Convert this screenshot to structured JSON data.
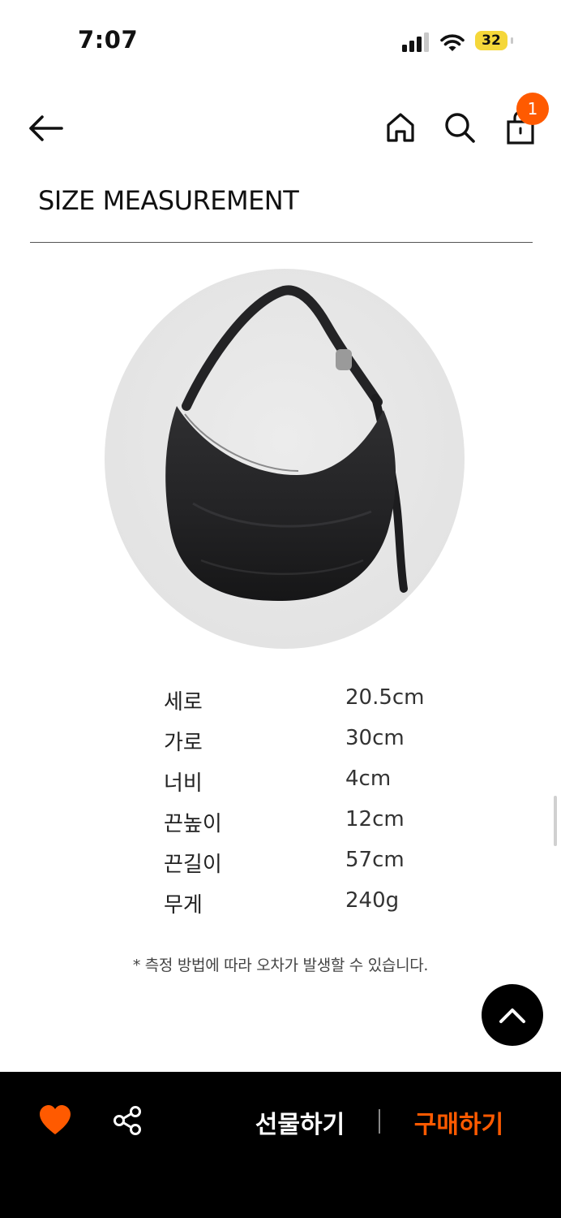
{
  "status_bar": {
    "time": "7:07",
    "battery": "32",
    "icons": [
      "cellular-signal-icon",
      "wifi-icon",
      "battery-icon"
    ]
  },
  "nav": {
    "back_icon": "arrow-left-icon",
    "home_icon": "home-icon",
    "search_icon": "search-icon",
    "cart_icon": "shopping-bag-icon",
    "cart_count": "1"
  },
  "section": {
    "title": "SIZE MEASUREMENT"
  },
  "specs": [
    {
      "label": "세로",
      "value": "20.5cm"
    },
    {
      "label": "가로",
      "value": "30cm"
    },
    {
      "label": "너비",
      "value": "4cm"
    },
    {
      "label": "끈높이",
      "value": "12cm"
    },
    {
      "label": "끈길이",
      "value": "57cm"
    },
    {
      "label": "무게",
      "value": "240g"
    }
  ],
  "note": "* 측정 방법에 따라 오차가 발생할 수 있습니다.",
  "bottom_bar": {
    "like_icon": "heart-icon",
    "share_icon": "share-icon",
    "gift_label": "선물하기",
    "buy_label": "구매하기"
  },
  "colors": {
    "accent": "#ff5a00",
    "battery": "#f5d73a",
    "bottom_bar": "#000000"
  }
}
